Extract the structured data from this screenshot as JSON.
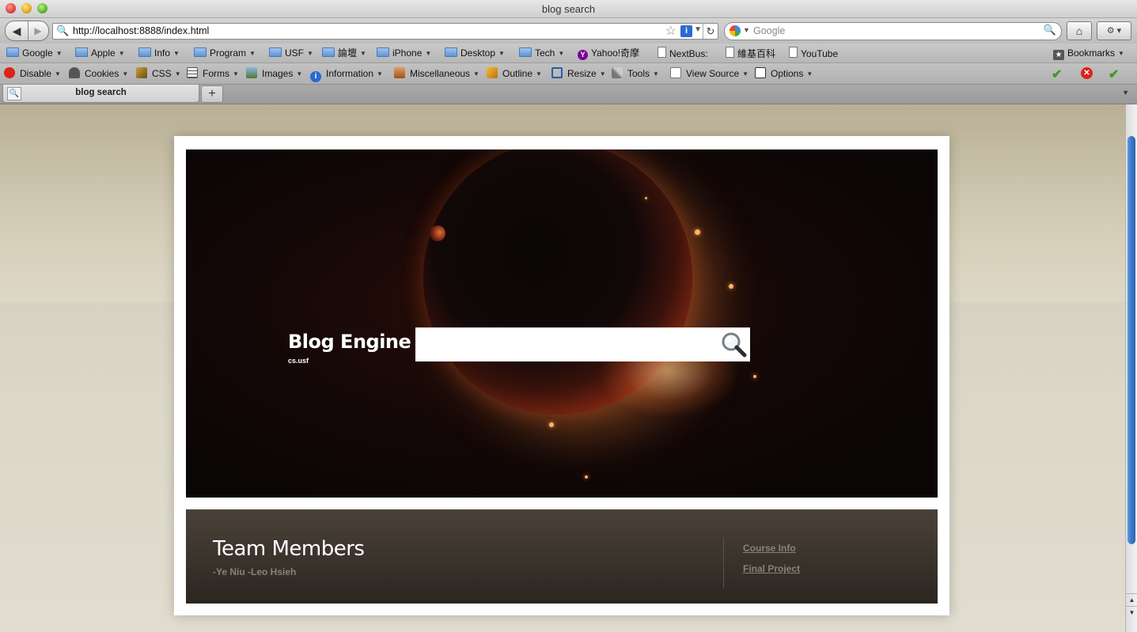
{
  "window": {
    "title": "blog search"
  },
  "navbar": {
    "url": "http://localhost:8888/index.html",
    "search_placeholder": "Google"
  },
  "bookmarks": {
    "items": [
      {
        "label": "Google",
        "icon": "folder-icon",
        "dropdown": true
      },
      {
        "label": "Apple",
        "icon": "folder-icon",
        "dropdown": true
      },
      {
        "label": "Info",
        "icon": "folder-icon",
        "dropdown": true
      },
      {
        "label": "Program",
        "icon": "folder-icon",
        "dropdown": true
      },
      {
        "label": "USF",
        "icon": "folder-icon",
        "dropdown": true
      },
      {
        "label": "論壇",
        "icon": "folder-icon",
        "dropdown": true
      },
      {
        "label": "iPhone",
        "icon": "folder-icon",
        "dropdown": true
      },
      {
        "label": "Desktop",
        "icon": "folder-icon",
        "dropdown": true
      },
      {
        "label": "Tech",
        "icon": "folder-icon",
        "dropdown": true
      },
      {
        "label": "Yahoo!奇摩",
        "icon": "yahoo-icon",
        "dropdown": false
      },
      {
        "label": "NextBus:",
        "icon": "page-icon",
        "dropdown": false
      },
      {
        "label": "維基百科",
        "icon": "page-icon",
        "dropdown": false
      },
      {
        "label": "YouTube",
        "icon": "page-icon",
        "dropdown": false
      }
    ],
    "bookmarks_menu": "Bookmarks"
  },
  "devbar": {
    "items": [
      {
        "label": "Disable",
        "icon": "disable-icon"
      },
      {
        "label": "Cookies",
        "icon": "cookies-icon"
      },
      {
        "label": "CSS",
        "icon": "css-icon"
      },
      {
        "label": "Forms",
        "icon": "forms-icon"
      },
      {
        "label": "Images",
        "icon": "images-icon"
      },
      {
        "label": "Information",
        "icon": "information-icon"
      },
      {
        "label": "Miscellaneous",
        "icon": "miscellaneous-icon"
      },
      {
        "label": "Outline",
        "icon": "outline-icon"
      },
      {
        "label": "Resize",
        "icon": "resize-icon"
      },
      {
        "label": "Tools",
        "icon": "tools-icon"
      },
      {
        "label": "View Source",
        "icon": "view-source-icon"
      },
      {
        "label": "Options",
        "icon": "options-icon"
      }
    ]
  },
  "tabs": [
    {
      "label": "blog search",
      "active": true
    }
  ],
  "page": {
    "brand_title": "Blog Engine",
    "brand_subtitle": "cs.usf",
    "search_value": "",
    "footer": {
      "heading": "Team Members",
      "names": "-Ye Niu -Leo Hsieh",
      "links": [
        "Course Info",
        "Final Project"
      ]
    }
  },
  "colors": {
    "card_bg": "#ffffff",
    "hero_bg": "#0b0606",
    "footer_bg": "#2c2621",
    "link_color": "#8a8275",
    "scroll_thumb": "#3a78c9"
  }
}
